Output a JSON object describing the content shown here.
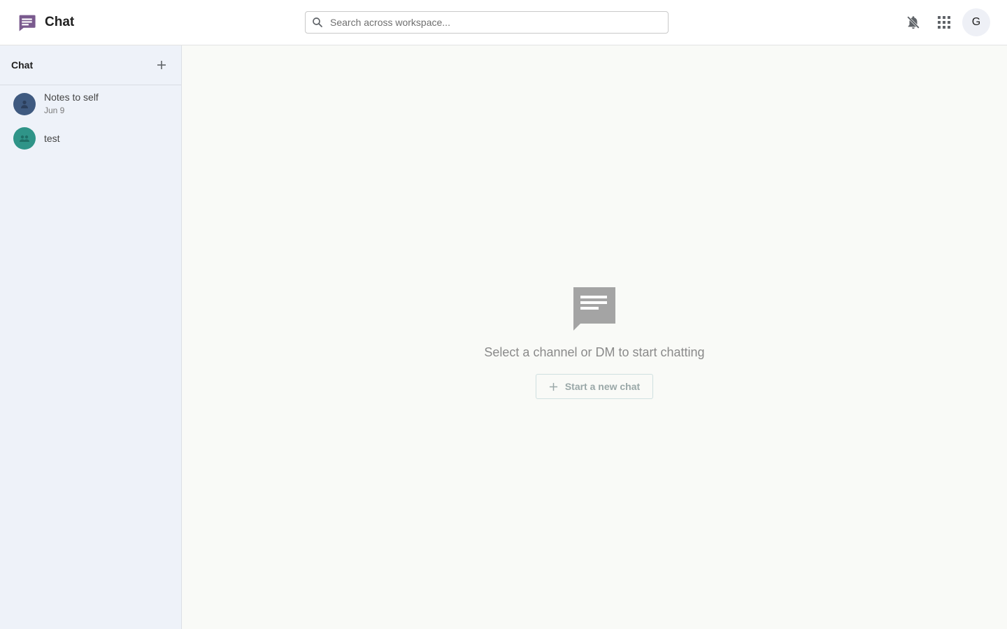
{
  "app": {
    "title": "Chat",
    "brand_color": "#7a5a8e"
  },
  "search": {
    "placeholder": "Search across workspace..."
  },
  "header": {
    "user_initial": "G",
    "icons": [
      "notifications-off-icon",
      "apps-grid-icon"
    ]
  },
  "sidebar": {
    "title": "Chat",
    "items": [
      {
        "name": "Notes to self",
        "date": "Jun 9",
        "avatar_color": "#3f5a80",
        "icon": "person-icon"
      },
      {
        "name": "test",
        "date": "",
        "avatar_color": "#2f9488",
        "icon": "group-icon"
      }
    ]
  },
  "main": {
    "empty_message": "Select a channel or DM to start chatting",
    "new_chat_label": "Start a new chat",
    "icon": "chat-bubble-icon"
  }
}
